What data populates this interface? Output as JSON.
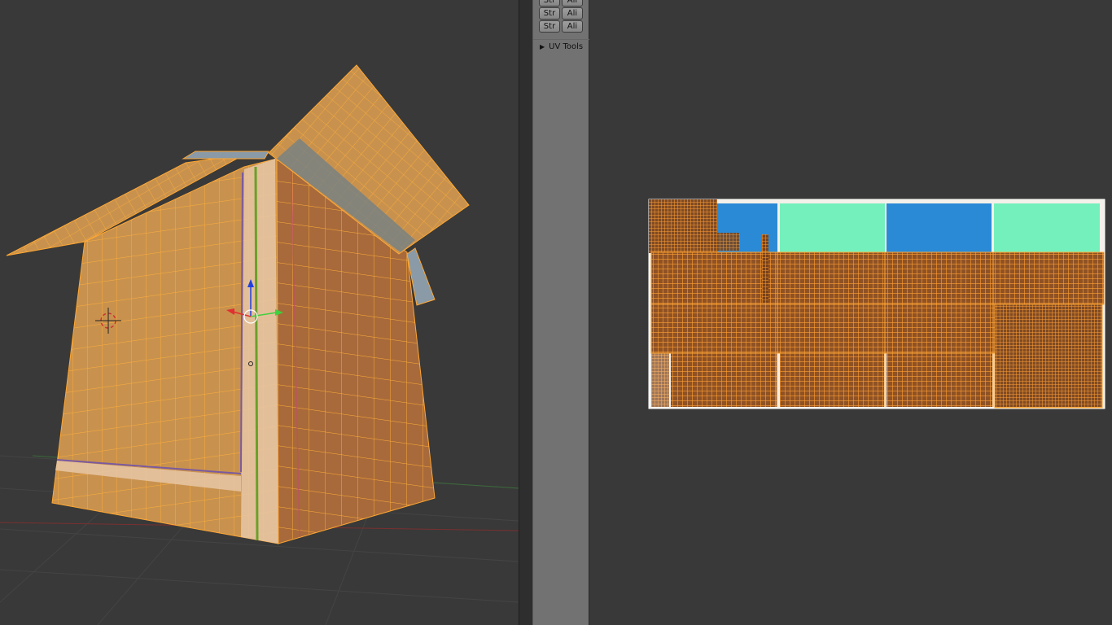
{
  "toolshelf": {
    "rows": [
      {
        "left": "Str",
        "right": "Ali"
      },
      {
        "left": "Str",
        "right": "Ali"
      },
      {
        "left": "Str",
        "right": "Ali"
      }
    ],
    "uv_tools_label": "UV Tools",
    "collapse_icon": "triangle-right-icon"
  },
  "colors": {
    "background": "#393939",
    "mesh_selected": "#c8924e",
    "wire_selected": "#ffa733",
    "uv_blue": "#2b8ad6",
    "uv_green": "#74f0bd",
    "axis_x": "#e03030",
    "axis_y": "#40d040",
    "axis_z": "#2040e0"
  }
}
